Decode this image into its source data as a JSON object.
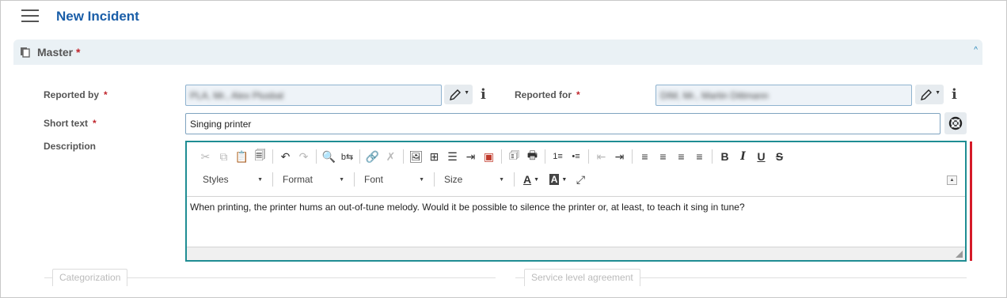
{
  "header": {
    "title": "New Incident"
  },
  "section": {
    "title": "Master",
    "required_mark": "*",
    "collapse_symbol": "^"
  },
  "form": {
    "reported_by": {
      "label": "Reported by",
      "required_mark": "*",
      "value": "PLA, Mr., Alex Plusbal"
    },
    "reported_for": {
      "label": "Reported for",
      "required_mark": "*",
      "value": "DIM, Mr., Martin Dittmann"
    },
    "short_text": {
      "label": "Short text",
      "required_mark": "*",
      "value": "Singing printer"
    },
    "description": {
      "label": "Description",
      "value": "When printing, the printer hums an out-of-tune melody. Would it be possible to silence the printer or, at least, to teach it sing in tune?"
    },
    "info_symbol": "i"
  },
  "editor_toolbar": {
    "styles": "Styles",
    "format": "Format",
    "font": "Font",
    "size": "Size",
    "bold": "B",
    "italic": "I",
    "underline": "U",
    "strike": "S"
  },
  "fieldsets": {
    "categorization": "Categorization",
    "sla": "Service level agreement"
  },
  "colors": {
    "title": "#1a5ea8",
    "editor_border": "#1f8d93",
    "required": "#c0262d",
    "validation_bar": "#d51a28"
  }
}
